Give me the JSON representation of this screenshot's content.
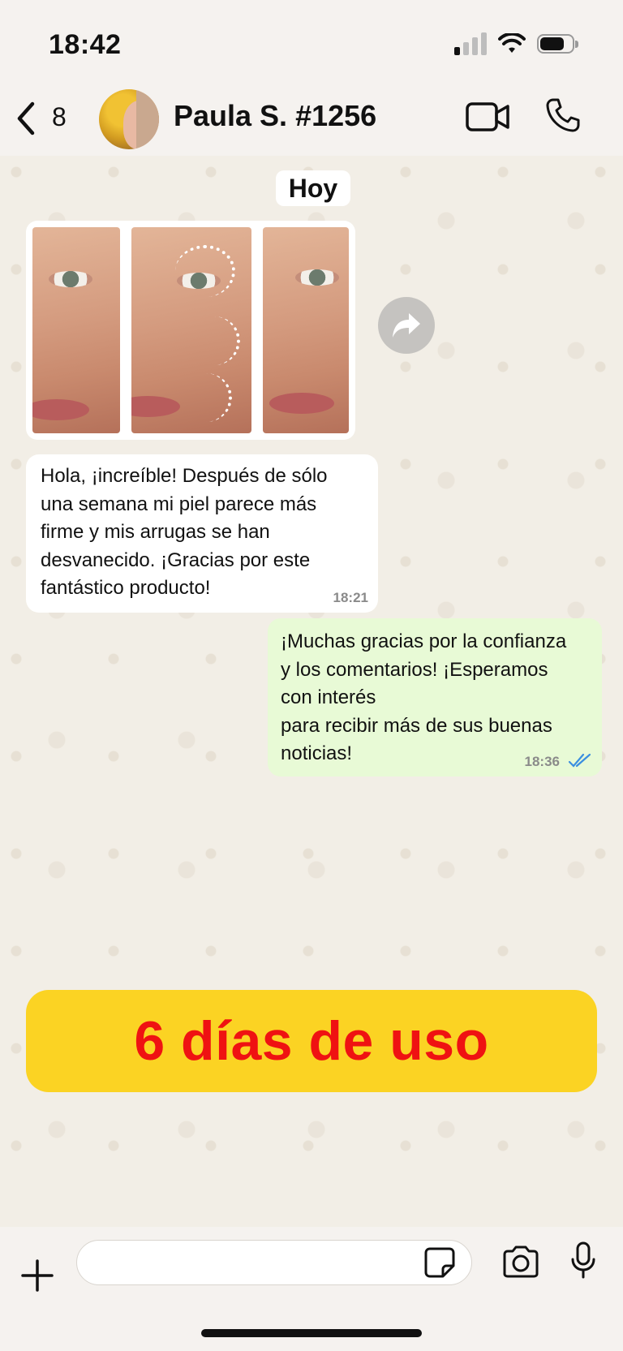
{
  "status": {
    "time": "18:42",
    "battery_level": 0.75,
    "signal_bars_active": 1
  },
  "header": {
    "unread_count": "8",
    "contact_name": "Paula S. #1256"
  },
  "chat": {
    "date_label": "Hoy",
    "messages": [
      {
        "direction": "incoming",
        "text": "Hola, ¡increíble! Después de sólo\nuna semana mi piel parece más\nfirme y mis arrugas se han\ndesvanecido. ¡Gracias por este\nfantástico producto!",
        "time": "18:21"
      },
      {
        "direction": "outgoing",
        "text": "¡Muchas gracias por la confianza\ny los comentarios! ¡Esperamos\ncon interés\npara recibir más de sus buenas\nnoticias!",
        "time": "18:36",
        "status": "read"
      }
    ]
  },
  "banner": {
    "text": "6 días de uso",
    "background": "#fbd323",
    "color": "#ef1212"
  },
  "composer": {
    "placeholder": ""
  },
  "colors": {
    "incoming_bubble": "#ffffff",
    "outgoing_bubble": "#e8fad6",
    "read_ticks": "#3b8fe0"
  }
}
